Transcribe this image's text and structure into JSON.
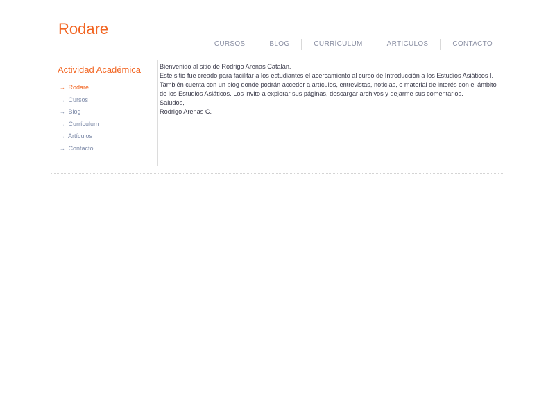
{
  "site": {
    "title": "Rodare"
  },
  "top_nav": {
    "items": [
      {
        "label": "CURSOS"
      },
      {
        "label": "BLOG"
      },
      {
        "label": "CURRÍCULUM"
      },
      {
        "label": "ARTÍCULOS"
      },
      {
        "label": "CONTACTO"
      }
    ]
  },
  "sidebar": {
    "heading": "Actividad Académica",
    "arrow": "→",
    "items": [
      {
        "label": "Rodare",
        "active": true
      },
      {
        "label": "Cursos"
      },
      {
        "label": "Blog"
      },
      {
        "label": "Currículum"
      },
      {
        "label": "Artículos"
      },
      {
        "label": "Contacto"
      }
    ]
  },
  "content": {
    "greeting": "Bienvenido al sitio de Rodrigo Arenas Catalán.",
    "body": "Este sitio fue creado para facilitar a los estudiantes el acercamiento al curso de Introducción a los Estudios Asiáticos I. También cuenta con un blog donde podrán acceder a artículos, entrevistas, noticias, o material de interés con el ámbito de los Estudios Asiáticos. Los invito a explorar sus páginas, descargar archivos y dejarme sus comentarios.",
    "closing": "Saludos,",
    "signature": "Rodrigo Arenas C."
  },
  "colors": {
    "accent": "#f26522",
    "nav_text": "#8a8fa3",
    "link": "#7d8aa8",
    "body_text": "#3a3a4a"
  }
}
